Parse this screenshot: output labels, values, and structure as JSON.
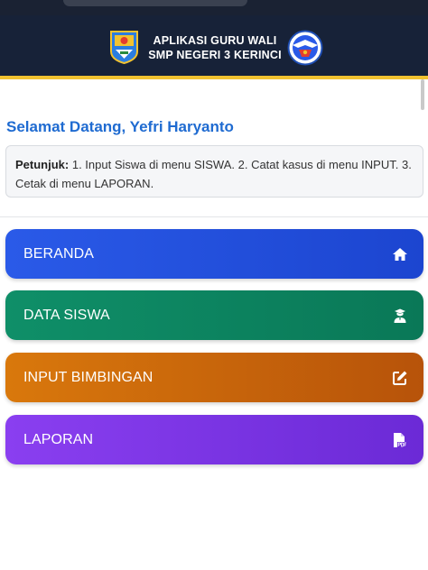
{
  "header": {
    "title_line1": "APLIKASI GURU WALI",
    "title_line2": "SMP NEGERI 3 KERINCI",
    "logo_left": "regency-emblem",
    "logo_right": "school-emblem"
  },
  "welcome": {
    "text": "Selamat Datang, Yefri Haryanto"
  },
  "hint": {
    "label": "Petunjuk:",
    "text": " 1. Input Siswa di menu SISWA. 2. Catat kasus di menu INPUT. 3. Cetak di menu LAPORAN."
  },
  "menu": [
    {
      "label": "BERANDA",
      "icon": "home-icon",
      "color": "#1c45d0"
    },
    {
      "label": "DATA SISWA",
      "icon": "student-icon",
      "color": "#0a7857"
    },
    {
      "label": "INPUT BIMBINGAN",
      "icon": "edit-icon",
      "color": "#b7530a"
    },
    {
      "label": "LAPORAN",
      "icon": "pdf-file-icon",
      "color": "#6b2ad6"
    }
  ],
  "colors": {
    "header_bg": "#172238",
    "header_accent": "#f2c230",
    "welcome_text": "#1f6bd1"
  }
}
